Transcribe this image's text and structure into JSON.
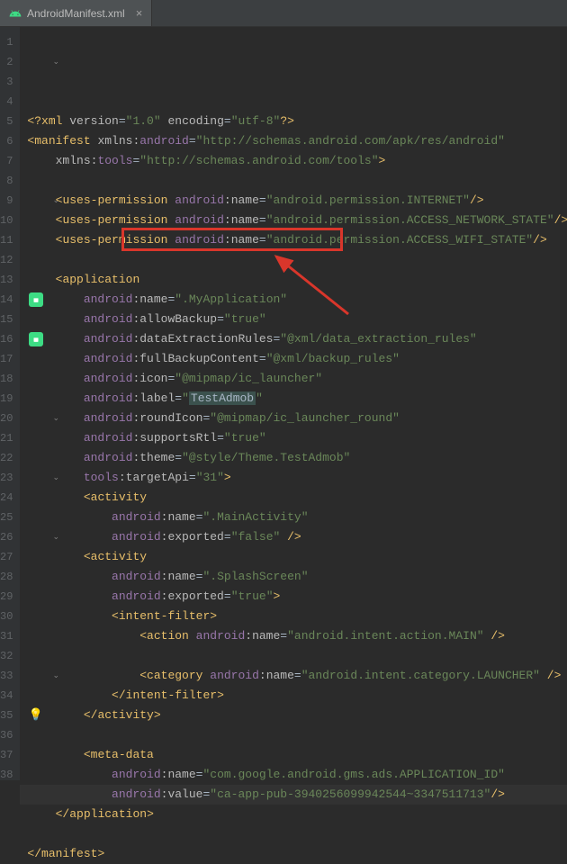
{
  "tab": {
    "filename": "AndroidManifest.xml",
    "icon": "android-icon"
  },
  "gutter": {
    "lines": [
      1,
      2,
      3,
      4,
      5,
      6,
      7,
      8,
      9,
      10,
      11,
      12,
      13,
      14,
      15,
      16,
      17,
      18,
      19,
      20,
      21,
      22,
      23,
      24,
      25,
      26,
      27,
      28,
      29,
      30,
      31,
      32,
      33,
      34,
      35,
      36,
      37,
      38
    ],
    "folds": [
      2,
      9,
      20,
      23,
      26,
      33
    ],
    "icons": {
      "14": "android",
      "16": "android",
      "35": "bulb"
    }
  },
  "code": {
    "lines": [
      {
        "n": 1,
        "t": [
          [
            "<?",
            "pun"
          ],
          [
            "xml ",
            "el"
          ],
          [
            "version",
            "attr"
          ],
          [
            "=",
            "eq"
          ],
          [
            "\"1.0\"",
            "str"
          ],
          [
            " ",
            "eq"
          ],
          [
            "encoding",
            "attr"
          ],
          [
            "=",
            "eq"
          ],
          [
            "\"utf-8\"",
            "str"
          ],
          [
            "?>",
            "pun"
          ]
        ]
      },
      {
        "n": 2,
        "t": [
          [
            "<",
            "pun"
          ],
          [
            "manifest ",
            "el"
          ],
          [
            "xmlns:",
            "attr"
          ],
          [
            "android",
            "ns"
          ],
          [
            "=",
            "eq"
          ],
          [
            "\"http://schemas.android.com/apk/res/android\"",
            "str"
          ]
        ]
      },
      {
        "n": 3,
        "i": 2,
        "t": [
          [
            "xmlns:",
            "attr"
          ],
          [
            "tools",
            "ns"
          ],
          [
            "=",
            "eq"
          ],
          [
            "\"http://schemas.android.com/tools\"",
            "str"
          ],
          [
            ">",
            "pun"
          ]
        ]
      },
      {
        "n": 4,
        "t": []
      },
      {
        "n": 5,
        "i": 2,
        "t": [
          [
            "<",
            "pun"
          ],
          [
            "uses-permission ",
            "el"
          ],
          [
            "android",
            "ns"
          ],
          [
            ":",
            "attr"
          ],
          [
            "name",
            "attr"
          ],
          [
            "=",
            "eq"
          ],
          [
            "\"android.permission.INTERNET\"",
            "str"
          ],
          [
            "/>",
            "pun"
          ]
        ]
      },
      {
        "n": 6,
        "i": 2,
        "t": [
          [
            "<",
            "pun"
          ],
          [
            "uses-permission ",
            "el"
          ],
          [
            "android",
            "ns"
          ],
          [
            ":",
            "attr"
          ],
          [
            "name",
            "attr"
          ],
          [
            "=",
            "eq"
          ],
          [
            "\"android.permission.ACCESS_NETWORK_STATE\"",
            "str"
          ],
          [
            "/>",
            "pun"
          ]
        ]
      },
      {
        "n": 7,
        "i": 2,
        "t": [
          [
            "<",
            "pun"
          ],
          [
            "uses-permission ",
            "el"
          ],
          [
            "android",
            "ns"
          ],
          [
            ":",
            "attr"
          ],
          [
            "name",
            "attr"
          ],
          [
            "=",
            "eq"
          ],
          [
            "\"android.permission.ACCESS_WIFI_STATE\"",
            "str"
          ],
          [
            "/>",
            "pun"
          ]
        ]
      },
      {
        "n": 8,
        "t": []
      },
      {
        "n": 9,
        "i": 2,
        "t": [
          [
            "<",
            "pun"
          ],
          [
            "application",
            "el"
          ]
        ]
      },
      {
        "n": 10,
        "i": 4,
        "t": [
          [
            "android",
            "ns"
          ],
          [
            ":",
            "attr"
          ],
          [
            "name",
            "attr"
          ],
          [
            "=",
            "eq"
          ],
          [
            "\".MyApplication\"",
            "str"
          ]
        ]
      },
      {
        "n": 11,
        "i": 4,
        "t": [
          [
            "android",
            "ns"
          ],
          [
            ":",
            "attr"
          ],
          [
            "allowBackup",
            "attr"
          ],
          [
            "=",
            "eq"
          ],
          [
            "\"true\"",
            "str"
          ]
        ]
      },
      {
        "n": 12,
        "i": 4,
        "t": [
          [
            "android",
            "ns"
          ],
          [
            ":",
            "attr"
          ],
          [
            "dataExtractionRules",
            "attr"
          ],
          [
            "=",
            "eq"
          ],
          [
            "\"@xml/data_extraction_rules\"",
            "str"
          ]
        ]
      },
      {
        "n": 13,
        "i": 4,
        "t": [
          [
            "android",
            "ns"
          ],
          [
            ":",
            "attr"
          ],
          [
            "fullBackupContent",
            "attr"
          ],
          [
            "=",
            "eq"
          ],
          [
            "\"@xml/backup_rules\"",
            "str"
          ]
        ]
      },
      {
        "n": 14,
        "i": 4,
        "t": [
          [
            "android",
            "ns"
          ],
          [
            ":",
            "attr"
          ],
          [
            "icon",
            "attr"
          ],
          [
            "=",
            "eq"
          ],
          [
            "\"@mipmap/ic_launcher\"",
            "str"
          ]
        ]
      },
      {
        "n": 15,
        "i": 4,
        "t": [
          [
            "android",
            "ns"
          ],
          [
            ":",
            "attr"
          ],
          [
            "label",
            "attr"
          ],
          [
            "=",
            "eq"
          ],
          [
            "\"",
            "str"
          ],
          [
            "TestAdmob",
            "lbl"
          ],
          [
            "\"",
            "str"
          ]
        ]
      },
      {
        "n": 16,
        "i": 4,
        "t": [
          [
            "android",
            "ns"
          ],
          [
            ":",
            "attr"
          ],
          [
            "roundIcon",
            "attr"
          ],
          [
            "=",
            "eq"
          ],
          [
            "\"@mipmap/ic_launcher_round\"",
            "str"
          ]
        ]
      },
      {
        "n": 17,
        "i": 4,
        "t": [
          [
            "android",
            "ns"
          ],
          [
            ":",
            "attr"
          ],
          [
            "supportsRtl",
            "attr"
          ],
          [
            "=",
            "eq"
          ],
          [
            "\"true\"",
            "str"
          ]
        ]
      },
      {
        "n": 18,
        "i": 4,
        "t": [
          [
            "android",
            "ns"
          ],
          [
            ":",
            "attr"
          ],
          [
            "theme",
            "attr"
          ],
          [
            "=",
            "eq"
          ],
          [
            "\"@style/Theme.TestAdmob\"",
            "str"
          ]
        ]
      },
      {
        "n": 19,
        "i": 4,
        "t": [
          [
            "tools",
            "ns"
          ],
          [
            ":",
            "attr"
          ],
          [
            "targetApi",
            "attr"
          ],
          [
            "=",
            "eq"
          ],
          [
            "\"31\"",
            "str"
          ],
          [
            ">",
            "pun"
          ]
        ]
      },
      {
        "n": 20,
        "i": 4,
        "t": [
          [
            "<",
            "pun"
          ],
          [
            "activity",
            "el"
          ]
        ]
      },
      {
        "n": 21,
        "i": 6,
        "t": [
          [
            "android",
            "ns"
          ],
          [
            ":",
            "attr"
          ],
          [
            "name",
            "attr"
          ],
          [
            "=",
            "eq"
          ],
          [
            "\".MainActivity\"",
            "str"
          ]
        ]
      },
      {
        "n": 22,
        "i": 6,
        "t": [
          [
            "android",
            "ns"
          ],
          [
            ":",
            "attr"
          ],
          [
            "exported",
            "attr"
          ],
          [
            "=",
            "eq"
          ],
          [
            "\"false\"",
            "str"
          ],
          [
            " />",
            "pun"
          ]
        ]
      },
      {
        "n": 23,
        "i": 4,
        "t": [
          [
            "<",
            "pun"
          ],
          [
            "activity",
            "el"
          ]
        ]
      },
      {
        "n": 24,
        "i": 6,
        "t": [
          [
            "android",
            "ns"
          ],
          [
            ":",
            "attr"
          ],
          [
            "name",
            "attr"
          ],
          [
            "=",
            "eq"
          ],
          [
            "\".SplashScreen\"",
            "str"
          ]
        ]
      },
      {
        "n": 25,
        "i": 6,
        "t": [
          [
            "android",
            "ns"
          ],
          [
            ":",
            "attr"
          ],
          [
            "exported",
            "attr"
          ],
          [
            "=",
            "eq"
          ],
          [
            "\"true\"",
            "str"
          ],
          [
            ">",
            "pun"
          ]
        ]
      },
      {
        "n": 26,
        "i": 6,
        "t": [
          [
            "<",
            "pun"
          ],
          [
            "intent-filter",
            "el"
          ],
          [
            ">",
            "pun"
          ]
        ]
      },
      {
        "n": 27,
        "i": 8,
        "t": [
          [
            "<",
            "pun"
          ],
          [
            "action ",
            "el"
          ],
          [
            "android",
            "ns"
          ],
          [
            ":",
            "attr"
          ],
          [
            "name",
            "attr"
          ],
          [
            "=",
            "eq"
          ],
          [
            "\"android.intent.action.MAIN\"",
            "str"
          ],
          [
            " />",
            "pun"
          ]
        ]
      },
      {
        "n": 28,
        "t": []
      },
      {
        "n": 29,
        "i": 8,
        "t": [
          [
            "<",
            "pun"
          ],
          [
            "category ",
            "el"
          ],
          [
            "android",
            "ns"
          ],
          [
            ":",
            "attr"
          ],
          [
            "name",
            "attr"
          ],
          [
            "=",
            "eq"
          ],
          [
            "\"android.intent.category.LAUNCHER\"",
            "str"
          ],
          [
            " />",
            "pun"
          ]
        ]
      },
      {
        "n": 30,
        "i": 6,
        "t": [
          [
            "</",
            "pun"
          ],
          [
            "intent-filter",
            "el"
          ],
          [
            ">",
            "pun"
          ]
        ]
      },
      {
        "n": 31,
        "i": 4,
        "t": [
          [
            "</",
            "pun"
          ],
          [
            "activity",
            "el"
          ],
          [
            ">",
            "pun"
          ]
        ]
      },
      {
        "n": 32,
        "t": []
      },
      {
        "n": 33,
        "i": 4,
        "t": [
          [
            "<",
            "pun"
          ],
          [
            "meta-data",
            "el"
          ]
        ]
      },
      {
        "n": 34,
        "i": 6,
        "t": [
          [
            "android",
            "ns"
          ],
          [
            ":",
            "attr"
          ],
          [
            "name",
            "attr"
          ],
          [
            "=",
            "eq"
          ],
          [
            "\"com.google.android.gms.ads.APPLICATION_ID\"",
            "str"
          ]
        ]
      },
      {
        "n": 35,
        "i": 6,
        "hl": true,
        "t": [
          [
            "android",
            "ns"
          ],
          [
            ":",
            "attr"
          ],
          [
            "value",
            "attr"
          ],
          [
            "=",
            "eq"
          ],
          [
            "\"ca-app-pub-3940256099942544~3347511713\"",
            "str"
          ],
          [
            "/>",
            "pun"
          ]
        ]
      },
      {
        "n": 36,
        "i": 2,
        "t": [
          [
            "</",
            "pun"
          ],
          [
            "application",
            "el"
          ],
          [
            ">",
            "pun"
          ]
        ]
      },
      {
        "n": 37,
        "t": []
      },
      {
        "n": 38,
        "t": [
          [
            "</",
            "pun"
          ],
          [
            "manifest",
            "el"
          ],
          [
            ">",
            "pun"
          ]
        ]
      }
    ]
  },
  "annotation": {
    "highlight_line": 10,
    "highlight_text": "android:name=\".MyApplication\"",
    "arrow_target_line": 11
  }
}
